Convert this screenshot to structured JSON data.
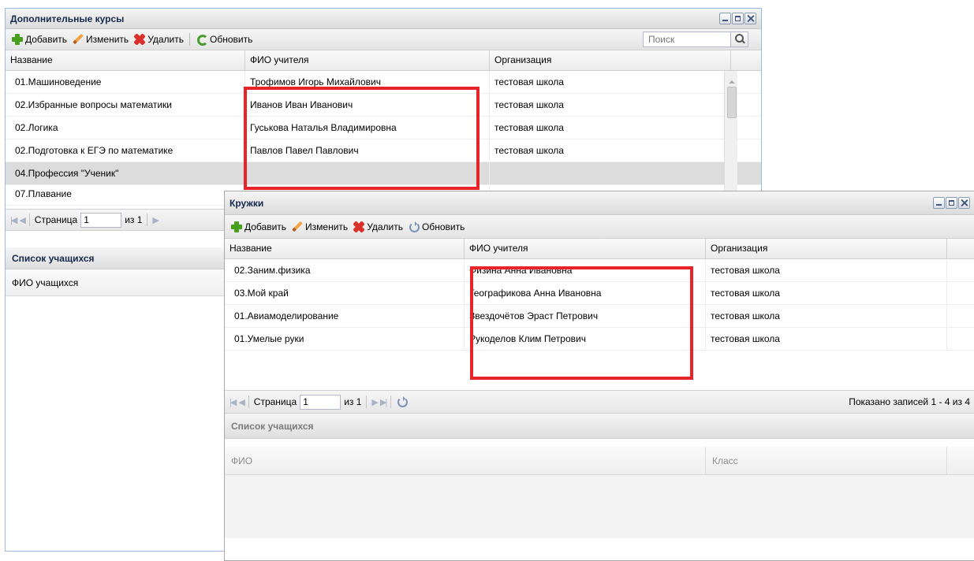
{
  "courses_window": {
    "title": "Дополнительные курсы",
    "toolbar": {
      "add": "Добавить",
      "edit": "Изменить",
      "delete": "Удалить",
      "refresh": "Обновить"
    },
    "search": {
      "placeholder": "Поиск"
    },
    "columns": [
      "Название",
      "ФИО учителя",
      "Организация"
    ],
    "rows": [
      {
        "name": "01.Машиноведение",
        "teacher": "Трофимов Игорь Михайлович",
        "org": "тестовая школа"
      },
      {
        "name": "02.Избранные вопросы математики",
        "teacher": "Иванов Иван Иванович",
        "org": "тестовая школа"
      },
      {
        "name": "02.Логика",
        "teacher": "Гуськова Наталья Владимировна",
        "org": "тестовая школа"
      },
      {
        "name": "02.Подготовка к ЕГЭ по математике",
        "teacher": "Павлов Павел Павлович",
        "org": "тестовая школа"
      },
      {
        "name": "04.Профессия \"Ученик\"",
        "teacher": "",
        "org": ""
      },
      {
        "name": "07.Плавание",
        "teacher": "",
        "org": ""
      }
    ],
    "pager": {
      "page_label": "Страница",
      "page": "1",
      "of": "из 1"
    },
    "students_title": "Список учащихся",
    "students_column": "ФИО учащихся"
  },
  "clubs_window": {
    "title": "Кружки",
    "toolbar": {
      "add": "Добавить",
      "edit": "Изменить",
      "delete": "Удалить",
      "refresh": "Обновить"
    },
    "columns": [
      "Название",
      "ФИО учителя",
      "Организация"
    ],
    "rows": [
      {
        "name": "02.Заним.физика",
        "teacher": "Физина Анна Ивановна",
        "org": "тестовая школа"
      },
      {
        "name": "03.Мой край",
        "teacher": "Географикова Анна Ивановна",
        "org": "тестовая школа"
      },
      {
        "name": "01.Авиамоделирование",
        "teacher": "Звездочётов Эраст Петрович",
        "org": "тестовая школа"
      },
      {
        "name": "01.Умелые руки",
        "teacher": "Рукоделов Клим Петрович",
        "org": "тестовая школа"
      }
    ],
    "pager": {
      "page_label": "Страница",
      "page": "1",
      "of": "из 1",
      "info": "Показано записей 1 - 4 из 4"
    },
    "students_title": "Список учащихся",
    "students_columns": [
      "ФИО",
      "Класс"
    ]
  },
  "colors": {
    "highlight": "#e8232a",
    "selected_row": "#dcdcdc",
    "title_text": "#15294b"
  }
}
